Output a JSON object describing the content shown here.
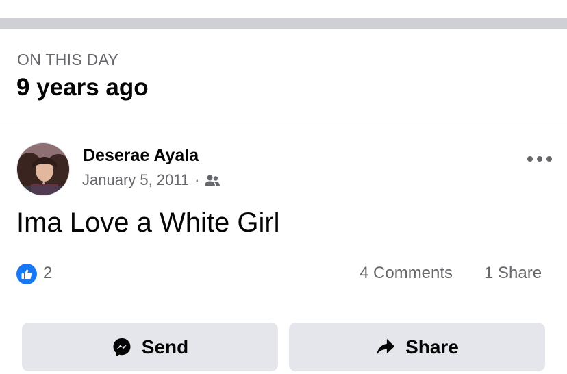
{
  "memory": {
    "kicker": "ON THIS DAY",
    "title": "9 years ago"
  },
  "post": {
    "author": "Deserae Ayala",
    "date": "January 5, 2011",
    "separator": "·",
    "audience_icon": "friends-icon",
    "text": "Ima Love a White Girl",
    "more_icon": "more-options-icon"
  },
  "stats": {
    "reaction_icon": "like-icon",
    "likes": "2",
    "comments": "4 Comments",
    "shares": "1 Share"
  },
  "actions": {
    "send_label": "Send",
    "send_icon": "messenger-icon",
    "share_label": "Share",
    "share_icon": "share-arrow-icon"
  },
  "colors": {
    "divider_bar": "#cfd0d5",
    "secondary_text": "#65676b",
    "like_blue": "#1877f2",
    "button_bg": "#e4e6eb"
  }
}
